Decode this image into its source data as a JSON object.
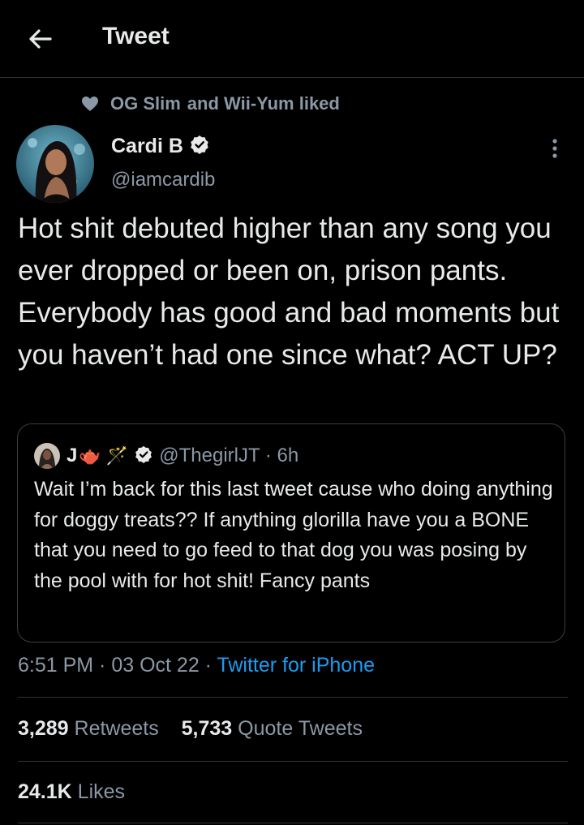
{
  "header": {
    "title": "Tweet"
  },
  "social_context": {
    "text_a": "OG Slim",
    "apple_glyph": "",
    "text_b": "and Wii-Yum liked"
  },
  "author": {
    "name": "Cardi B",
    "handle": "@iamcardib"
  },
  "tweet": {
    "text": "Hot shit debuted higher than any song you ever dropped or been on, prison pants. Everybody has good and bad moments but you haven’t had one since what? ACT UP?"
  },
  "quoted_tweet": {
    "name": "J",
    "emoji": "🫖 🪄",
    "handle_time": "@ThegirlJT · 6h",
    "text": "Wait I’m back for this last tweet cause who doing anything for doggy treats?? If anything glorilla have you a BONE that you need to go feed to that dog you was posing by the pool with for hot shit! Fancy pants"
  },
  "meta": {
    "time_date": "6:51 PM · 03 Oct 22 · ",
    "source": "Twitter for iPhone"
  },
  "stats": {
    "retweets_count": "3,289",
    "retweets_label": "Retweets",
    "quotes_count": "5,733",
    "quotes_label": "Quote Tweets",
    "likes_count": "24.1K",
    "likes_label": "Likes"
  },
  "colors": {
    "background": "#000000",
    "text": "#e7e9ea",
    "secondary": "#8b98a5",
    "link": "#1d9bf0",
    "border": "#2f3336"
  }
}
